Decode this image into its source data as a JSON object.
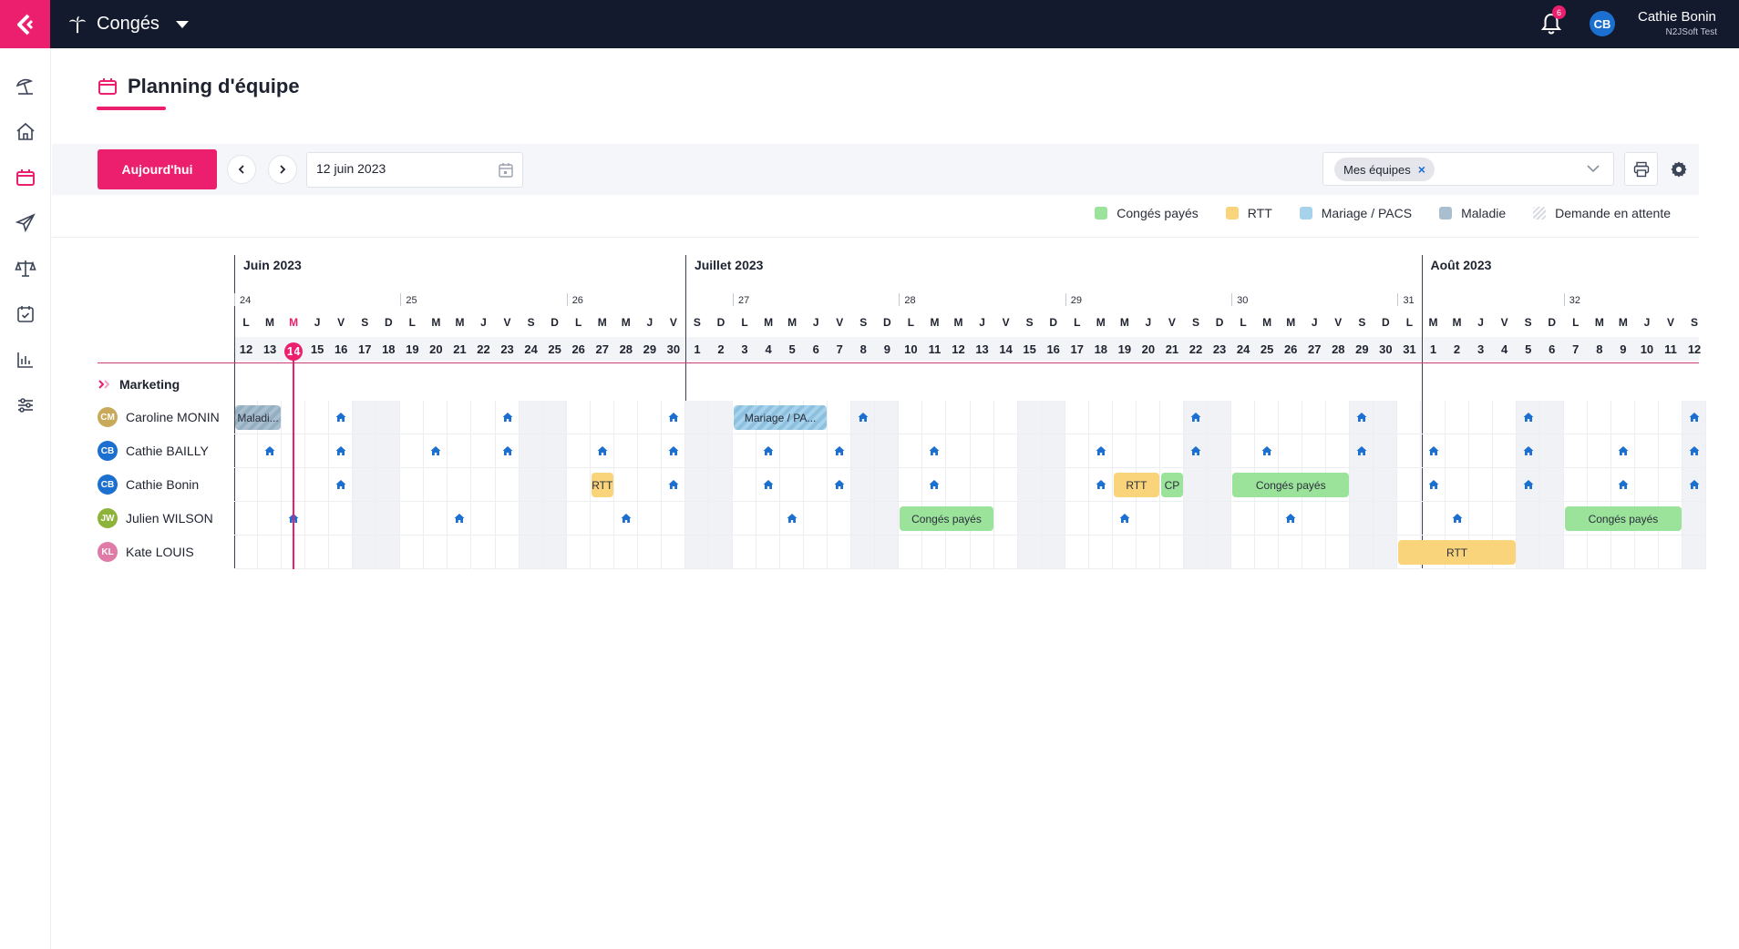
{
  "app": {
    "title": "Congés",
    "icon": "palm-tree-icon"
  },
  "user": {
    "initials": "CB",
    "name": "Cathie Bonin",
    "company": "N2JSoft Test",
    "notifications": "6"
  },
  "sidebar": {
    "items": [
      {
        "id": "leave",
        "icon": "beach-umbrella-icon"
      },
      {
        "id": "home",
        "icon": "home-icon"
      },
      {
        "id": "planning",
        "icon": "calendar-icon",
        "active": true
      },
      {
        "id": "requests",
        "icon": "send-icon"
      },
      {
        "id": "balance",
        "icon": "scales-icon"
      },
      {
        "id": "validation",
        "icon": "calendar-check-icon"
      },
      {
        "id": "reports",
        "icon": "bar-chart-icon"
      },
      {
        "id": "settings",
        "icon": "sliders-icon"
      }
    ]
  },
  "page": {
    "title": "Planning d'équipe"
  },
  "toolbar": {
    "today_label": "Aujourd'hui",
    "date_value": "12 juin 2023",
    "team_chip": "Mes équipes",
    "team_chip_remove": "×"
  },
  "legend": [
    {
      "label": "Congés payés",
      "color": "#9be39a"
    },
    {
      "label": "RTT",
      "color": "#f9d47b"
    },
    {
      "label": "Mariage / PACS",
      "color": "#a7d2ec"
    },
    {
      "label": "Maladie",
      "color": "#a9bfd0"
    },
    {
      "label": "Demande en attente",
      "color": "hatched"
    }
  ],
  "calendar": {
    "months": [
      {
        "label": "Juin 2023",
        "start_index": 0
      },
      {
        "label": "Juillet 2023",
        "start_index": 19
      },
      {
        "label": "Août 2023",
        "start_index": 50
      }
    ],
    "weeks": [
      {
        "num": "24",
        "start_index": 0
      },
      {
        "num": "25",
        "start_index": 7
      },
      {
        "num": "26",
        "start_index": 14
      },
      {
        "num": "27",
        "start_index": 21
      },
      {
        "num": "28",
        "start_index": 28
      },
      {
        "num": "29",
        "start_index": 35
      },
      {
        "num": "30",
        "start_index": 42
      },
      {
        "num": "31",
        "start_index": 49
      },
      {
        "num": "32",
        "start_index": 56
      }
    ],
    "days": [
      {
        "d": "L",
        "n": "12"
      },
      {
        "d": "M",
        "n": "13"
      },
      {
        "d": "M",
        "n": "14",
        "today": true
      },
      {
        "d": "J",
        "n": "15"
      },
      {
        "d": "V",
        "n": "16"
      },
      {
        "d": "S",
        "n": "17"
      },
      {
        "d": "D",
        "n": "18"
      },
      {
        "d": "L",
        "n": "19"
      },
      {
        "d": "M",
        "n": "20"
      },
      {
        "d": "M",
        "n": "21"
      },
      {
        "d": "J",
        "n": "22"
      },
      {
        "d": "V",
        "n": "23"
      },
      {
        "d": "S",
        "n": "24"
      },
      {
        "d": "D",
        "n": "25"
      },
      {
        "d": "L",
        "n": "26"
      },
      {
        "d": "M",
        "n": "27"
      },
      {
        "d": "M",
        "n": "28"
      },
      {
        "d": "J",
        "n": "29"
      },
      {
        "d": "V",
        "n": "30"
      },
      {
        "d": "S",
        "n": "1"
      },
      {
        "d": "D",
        "n": "2"
      },
      {
        "d": "L",
        "n": "3"
      },
      {
        "d": "M",
        "n": "4"
      },
      {
        "d": "M",
        "n": "5"
      },
      {
        "d": "J",
        "n": "6"
      },
      {
        "d": "V",
        "n": "7"
      },
      {
        "d": "S",
        "n": "8"
      },
      {
        "d": "D",
        "n": "9"
      },
      {
        "d": "L",
        "n": "10"
      },
      {
        "d": "M",
        "n": "11"
      },
      {
        "d": "M",
        "n": "12"
      },
      {
        "d": "J",
        "n": "13"
      },
      {
        "d": "V",
        "n": "14"
      },
      {
        "d": "S",
        "n": "15"
      },
      {
        "d": "D",
        "n": "16"
      },
      {
        "d": "L",
        "n": "17"
      },
      {
        "d": "M",
        "n": "18"
      },
      {
        "d": "M",
        "n": "19"
      },
      {
        "d": "J",
        "n": "20"
      },
      {
        "d": "V",
        "n": "21"
      },
      {
        "d": "S",
        "n": "22"
      },
      {
        "d": "D",
        "n": "23"
      },
      {
        "d": "L",
        "n": "24"
      },
      {
        "d": "M",
        "n": "25"
      },
      {
        "d": "M",
        "n": "26"
      },
      {
        "d": "J",
        "n": "27"
      },
      {
        "d": "V",
        "n": "28"
      },
      {
        "d": "S",
        "n": "29"
      },
      {
        "d": "D",
        "n": "30"
      },
      {
        "d": "L",
        "n": "31"
      },
      {
        "d": "M",
        "n": "1"
      },
      {
        "d": "M",
        "n": "2"
      },
      {
        "d": "J",
        "n": "3"
      },
      {
        "d": "V",
        "n": "4"
      },
      {
        "d": "S",
        "n": "5"
      },
      {
        "d": "D",
        "n": "6"
      },
      {
        "d": "L",
        "n": "7"
      },
      {
        "d": "M",
        "n": "8"
      },
      {
        "d": "M",
        "n": "9"
      },
      {
        "d": "J",
        "n": "10"
      },
      {
        "d": "V",
        "n": "11"
      },
      {
        "d": "S",
        "n": "12"
      }
    ],
    "group": {
      "name": "Marketing"
    },
    "people": [
      {
        "initials": "CM",
        "name": "Caroline MONIN",
        "color": "#c9a95a",
        "remote_days": [
          4,
          11,
          18,
          26,
          40,
          47,
          54,
          61
        ],
        "events": [
          {
            "label": "Maladi...",
            "type": "Maladie",
            "pending": true,
            "start": 0,
            "span": 2
          },
          {
            "label": "Mariage / PA...",
            "type": "Mariage / PACS",
            "pending": true,
            "start": 21,
            "span": 4
          }
        ]
      },
      {
        "initials": "CB",
        "name": "Cathie BAILLY",
        "color": "#1a6fd1",
        "remote_days": [
          1,
          4,
          8,
          11,
          15,
          18,
          22,
          25,
          29,
          36,
          40,
          43,
          47,
          50,
          54,
          58,
          61
        ],
        "events": []
      },
      {
        "initials": "CB",
        "name": "Cathie Bonin",
        "color": "#1a6fd1",
        "remote_days": [
          4,
          18,
          22,
          25,
          29,
          36,
          50,
          54,
          58,
          61
        ],
        "events": [
          {
            "label": "RTT",
            "type": "RTT",
            "start": 15,
            "span": 1
          },
          {
            "label": "RTT",
            "type": "RTT",
            "start": 37,
            "span": 2
          },
          {
            "label": "CP",
            "type": "Congés payés",
            "start": 39,
            "span": 1
          },
          {
            "label": "Congés payés",
            "type": "Congés payés",
            "start": 42,
            "span": 5
          }
        ]
      },
      {
        "initials": "JW",
        "name": "Julien WILSON",
        "color": "#8db33a",
        "remote_days": [
          2,
          9,
          16,
          23,
          37,
          44,
          51
        ],
        "events": [
          {
            "label": "Congés payés",
            "type": "Congés payés",
            "start": 28,
            "span": 4
          },
          {
            "label": "Congés payés",
            "type": "Congés payés",
            "start": 56,
            "span": 5
          }
        ]
      },
      {
        "initials": "KL",
        "name": "Kate LOUIS",
        "color": "#e07aa6",
        "remote_days": [],
        "events": [
          {
            "label": "RTT",
            "type": "RTT",
            "start": 49,
            "span": 5
          }
        ]
      }
    ]
  }
}
